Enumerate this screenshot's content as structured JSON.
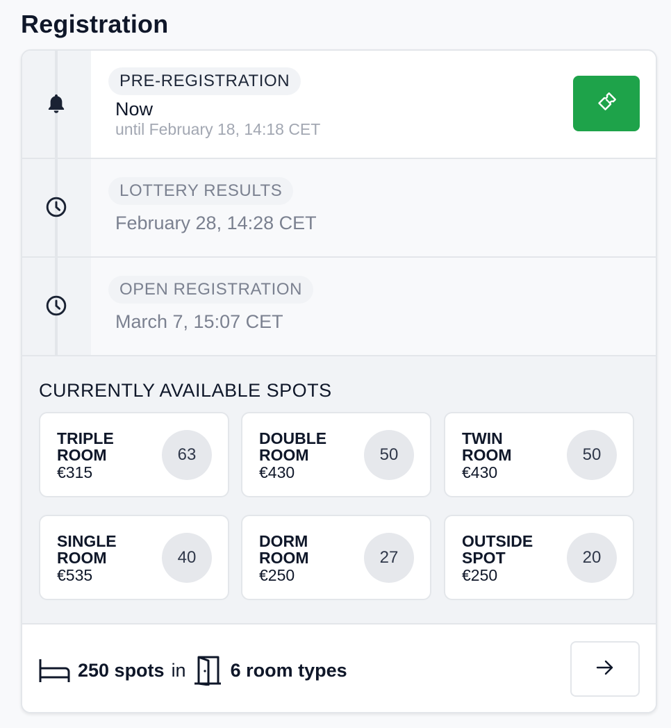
{
  "page": {
    "title": "Registration"
  },
  "timeline": {
    "steps": [
      {
        "label": "PRE-REGISTRATION",
        "when": "Now",
        "until": "until February 18, 14:18 CET",
        "icon": "bell-icon",
        "active": true
      },
      {
        "label": "LOTTERY RESULTS",
        "when": "February 28, 14:28 CET",
        "icon": "clock-icon",
        "active": false
      },
      {
        "label": "OPEN REGISTRATION",
        "when": "March 7, 15:07 CET",
        "icon": "clock-icon",
        "active": false
      }
    ],
    "action_icon": "ticket-icon",
    "action_color": "#1ea34a"
  },
  "availability": {
    "title": "CURRENTLY AVAILABLE SPOTS",
    "rooms": [
      {
        "name": "TRIPLE ROOM",
        "price": "€315",
        "count": "63"
      },
      {
        "name": "DOUBLE ROOM",
        "price": "€430",
        "count": "50"
      },
      {
        "name": "TWIN ROOM",
        "price": "€430",
        "count": "50"
      },
      {
        "name": "SINGLE ROOM",
        "price": "€535",
        "count": "40"
      },
      {
        "name": "DORM ROOM",
        "price": "€250",
        "count": "27"
      },
      {
        "name": "OUTSIDE SPOT",
        "price": "€250",
        "count": "20"
      }
    ]
  },
  "footer": {
    "spots": "250 spots",
    "connector": "in",
    "room_types": "6 room types",
    "bed_icon": "bed-icon",
    "door_icon": "door-icon",
    "next_icon": "arrow-right-icon"
  }
}
